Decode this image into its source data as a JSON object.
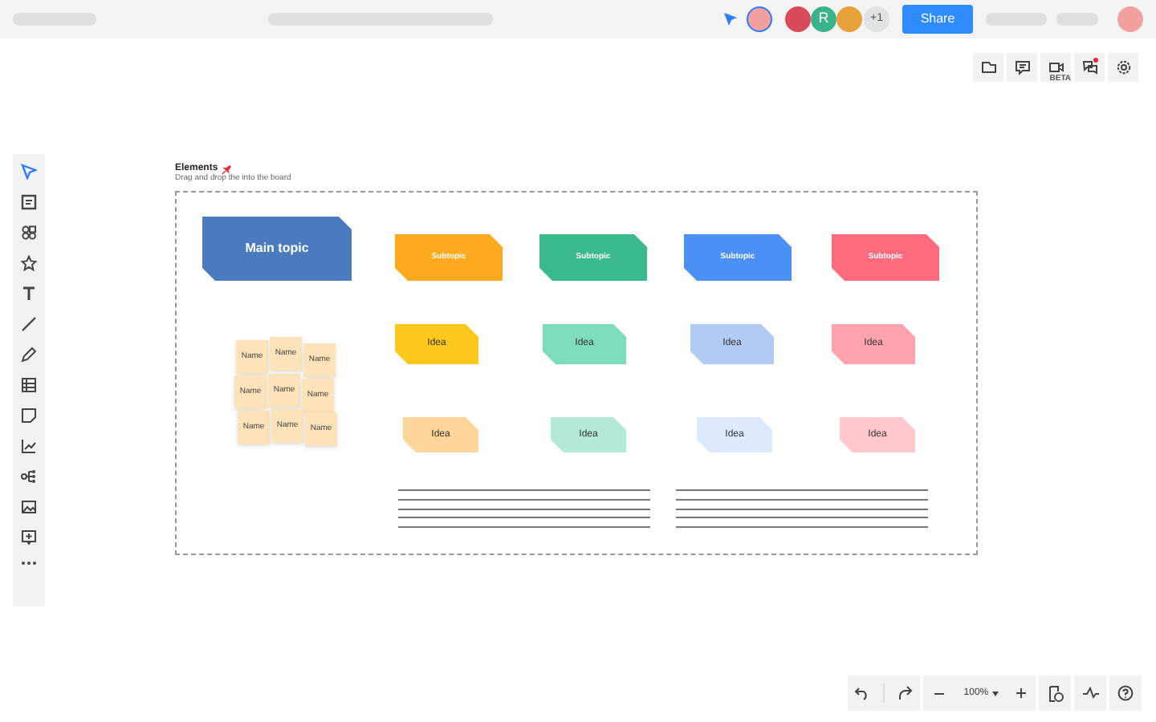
{
  "header": {
    "share_label": "Share",
    "avatar_initial": "R",
    "extra_count": "+1"
  },
  "frame": {
    "title": "Elements",
    "subtitle": "Drag and drop the into the board"
  },
  "main_topic": {
    "label": "Main topic",
    "color": "#4a7bbf"
  },
  "subtopics": [
    {
      "label": "Subtopic",
      "color": "#ffa91e"
    },
    {
      "label": "Subtopic",
      "color": "#3bba8c"
    },
    {
      "label": "Subtopic",
      "color": "#4a90f5"
    },
    {
      "label": "Subtopic",
      "color": "#ff6b7e"
    }
  ],
  "ideas": [
    {
      "label": "Idea",
      "color": "#ffc81f"
    },
    {
      "label": "Idea",
      "color": "#7ddcb9"
    },
    {
      "label": "Idea",
      "color": "#b2cbf3"
    },
    {
      "label": "Idea",
      "color": "#ffa4ae"
    }
  ],
  "small_ideas": [
    {
      "label": "Idea",
      "color": "#ffd699"
    },
    {
      "label": "Idea",
      "color": "#b2ead6"
    },
    {
      "label": "Idea",
      "color": "#dde9fc"
    },
    {
      "label": "Idea",
      "color": "#ffc8cf"
    }
  ],
  "notes": [
    "Name",
    "Name",
    "Name",
    "Name",
    "Name",
    "Name",
    "Name",
    "Name",
    "Name"
  ],
  "zoom": {
    "value": "100%"
  },
  "right_tools": [
    {
      "kind": "plain"
    },
    {
      "kind": "plain"
    },
    {
      "kind": "beta",
      "badge": "BETA"
    },
    {
      "kind": "alert"
    },
    {
      "kind": "plain"
    }
  ]
}
